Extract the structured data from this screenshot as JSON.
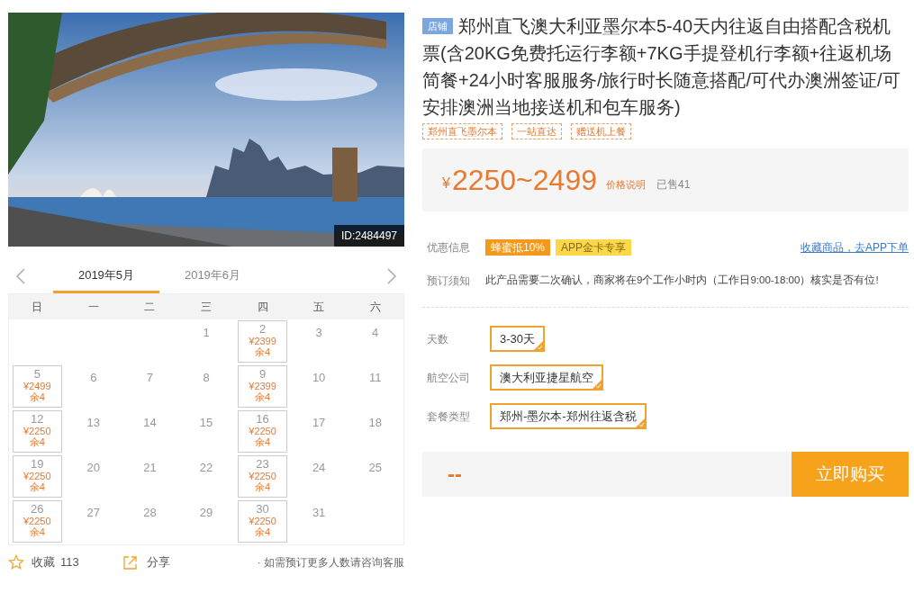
{
  "gallery": {
    "id_badge": "ID:2484497"
  },
  "calendar": {
    "months": [
      {
        "label": "2019年5月",
        "selected": true
      },
      {
        "label": "2019年6月",
        "selected": false
      }
    ],
    "weekdays": [
      "日",
      "一",
      "二",
      "三",
      "四",
      "五",
      "六"
    ],
    "weeks": [
      [
        {
          "kind": "blank"
        },
        {
          "kind": "blank"
        },
        {
          "kind": "blank"
        },
        {
          "kind": "plain",
          "day": "1"
        },
        {
          "kind": "priced",
          "day": "2",
          "price": "¥2399",
          "remaining": "余4"
        },
        {
          "kind": "plain",
          "day": "3"
        },
        {
          "kind": "plain",
          "day": "4"
        }
      ],
      [
        {
          "kind": "priced",
          "day": "5",
          "price": "¥2499",
          "remaining": "余4"
        },
        {
          "kind": "plain",
          "day": "6"
        },
        {
          "kind": "plain",
          "day": "7"
        },
        {
          "kind": "plain",
          "day": "8"
        },
        {
          "kind": "priced",
          "day": "9",
          "price": "¥2399",
          "remaining": "余4"
        },
        {
          "kind": "plain",
          "day": "10"
        },
        {
          "kind": "plain",
          "day": "11"
        }
      ],
      [
        {
          "kind": "priced",
          "day": "12",
          "price": "¥2250",
          "remaining": "余4"
        },
        {
          "kind": "plain",
          "day": "13"
        },
        {
          "kind": "plain",
          "day": "14"
        },
        {
          "kind": "plain",
          "day": "15"
        },
        {
          "kind": "priced",
          "day": "16",
          "price": "¥2250",
          "remaining": "余4"
        },
        {
          "kind": "plain",
          "day": "17"
        },
        {
          "kind": "plain",
          "day": "18"
        }
      ],
      [
        {
          "kind": "priced",
          "day": "19",
          "price": "¥2250",
          "remaining": "余4"
        },
        {
          "kind": "plain",
          "day": "20"
        },
        {
          "kind": "plain",
          "day": "21"
        },
        {
          "kind": "plain",
          "day": "22"
        },
        {
          "kind": "priced",
          "day": "23",
          "price": "¥2250",
          "remaining": "余4"
        },
        {
          "kind": "plain",
          "day": "24"
        },
        {
          "kind": "plain",
          "day": "25"
        }
      ],
      [
        {
          "kind": "priced",
          "day": "26",
          "price": "¥2250",
          "remaining": "余4"
        },
        {
          "kind": "plain",
          "day": "27"
        },
        {
          "kind": "plain",
          "day": "28"
        },
        {
          "kind": "plain",
          "day": "29"
        },
        {
          "kind": "priced",
          "day": "30",
          "price": "¥2250",
          "remaining": "余4"
        },
        {
          "kind": "plain",
          "day": "31"
        },
        {
          "kind": "blank"
        }
      ]
    ]
  },
  "actions": {
    "favorite": {
      "label": "收藏",
      "count": "113"
    },
    "share": {
      "label": "分享"
    },
    "note": "· 如需预订更多人数请咨询客服"
  },
  "product": {
    "store_badge": "店铺",
    "title": "郑州直飞澳大利亚墨尔本5-40天内往返自由搭配含税机票(含20KG免费托运行李额+7KG手提登机行李额+往返机场简餐+24小时客服服务/旅行时长随意搭配/可代办澳洲签证/可安排澳洲当地接送机和包车服务)",
    "tags": [
      "郑州直飞墨尔本",
      "一站直达",
      "赠送机上餐"
    ],
    "price": {
      "currency": "¥",
      "range": "2250~2499",
      "explain_link": "价格说明",
      "sold": "已售41"
    }
  },
  "promotions": {
    "label": "优惠信息",
    "badges": [
      {
        "text": "蜂蜜抵10%",
        "color": "#f39a1e"
      },
      {
        "text": "APP金卡专享",
        "color": "#fad84a"
      }
    ],
    "app_link": "收藏商品，去APP下单"
  },
  "notice": {
    "label": "预订须知",
    "text": "此产品需要二次确认，商家将在9个工作小时内（工作日9:00-18:00）核实是否有位!"
  },
  "options": [
    {
      "label": "天数",
      "choices": [
        {
          "text": "3-30天",
          "selected": true
        }
      ]
    },
    {
      "label": "航空公司",
      "choices": [
        {
          "text": "澳大利亚捷星航空",
          "selected": true
        }
      ]
    },
    {
      "label": "套餐类型",
      "choices": [
        {
          "text": "郑州-墨尔本-郑州往返含税",
          "selected": true
        }
      ]
    }
  ],
  "purchase": {
    "total": "--",
    "buy_button": "立即购买"
  }
}
